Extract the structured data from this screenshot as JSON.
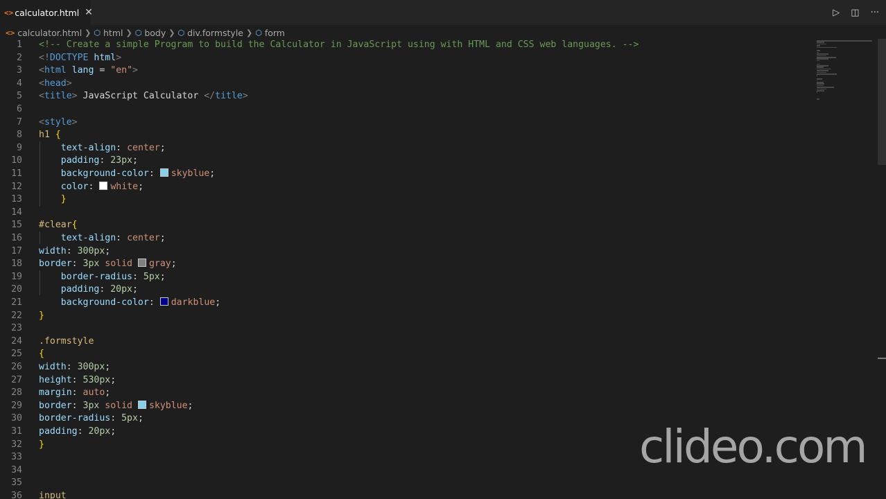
{
  "tab": {
    "filename": "calculator.html",
    "close_glyph": "✕"
  },
  "actions": {
    "run_glyph": "▷",
    "split_glyph": "◫",
    "more_glyph": "···"
  },
  "breadcrumb": [
    "calculator.html",
    "html",
    "body",
    "div.formstyle",
    "form"
  ],
  "swatch_colors": {
    "skyblue": "#87ceeb",
    "white": "#ffffff",
    "gray": "#808080",
    "darkblue": "#00008b"
  },
  "watermark": "clideo.com",
  "lines": [
    {
      "n": "1",
      "t": [
        {
          "c": "comment",
          "v": "<!-- Create a simple Program to build the Calculator in JavaScript using with HTML and CSS web languages. -->"
        }
      ]
    },
    {
      "n": "2",
      "t": [
        {
          "c": "tag",
          "v": "<!"
        },
        {
          "c": "tagname",
          "v": "DOCTYPE "
        },
        {
          "c": "attr",
          "v": "html"
        },
        {
          "c": "tag",
          "v": ">"
        }
      ]
    },
    {
      "n": "3",
      "t": [
        {
          "c": "tag",
          "v": "<"
        },
        {
          "c": "tagname",
          "v": "html "
        },
        {
          "c": "attr",
          "v": "lang "
        },
        {
          "c": "text",
          "v": "= "
        },
        {
          "c": "str",
          "v": "\"en\""
        },
        {
          "c": "tag",
          "v": ">"
        }
      ]
    },
    {
      "n": "4",
      "t": [
        {
          "c": "tag",
          "v": "<"
        },
        {
          "c": "tagname",
          "v": "head"
        },
        {
          "c": "tag",
          "v": ">"
        }
      ]
    },
    {
      "n": "5",
      "t": [
        {
          "c": "tag",
          "v": "<"
        },
        {
          "c": "tagname",
          "v": "title"
        },
        {
          "c": "tag",
          "v": ">"
        },
        {
          "c": "text",
          "v": " JavaScript Calculator "
        },
        {
          "c": "tag",
          "v": "</"
        },
        {
          "c": "tagname",
          "v": "title"
        },
        {
          "c": "tag",
          "v": ">"
        }
      ]
    },
    {
      "n": "6",
      "t": []
    },
    {
      "n": "7",
      "t": [
        {
          "c": "tag",
          "v": "<"
        },
        {
          "c": "tagname",
          "v": "style"
        },
        {
          "c": "tag",
          "v": ">"
        }
      ]
    },
    {
      "n": "8",
      "t": [
        {
          "c": "sel",
          "v": "h1 "
        },
        {
          "c": "brace",
          "v": "{"
        }
      ]
    },
    {
      "n": "9",
      "t": [
        {
          "c": "text",
          "v": "    "
        },
        {
          "c": "prop",
          "v": "text-align"
        },
        {
          "c": "text",
          "v": ": "
        },
        {
          "c": "val",
          "v": "center"
        },
        {
          "c": "text",
          "v": ";"
        }
      ]
    },
    {
      "n": "10",
      "t": [
        {
          "c": "text",
          "v": "    "
        },
        {
          "c": "prop",
          "v": "padding"
        },
        {
          "c": "text",
          "v": ": "
        },
        {
          "c": "num",
          "v": "23px"
        },
        {
          "c": "text",
          "v": ";"
        }
      ]
    },
    {
      "n": "11",
      "t": [
        {
          "c": "text",
          "v": "    "
        },
        {
          "c": "prop",
          "v": "background-color"
        },
        {
          "c": "text",
          "v": ": "
        },
        {
          "c": "swatch",
          "v": "skyblue"
        },
        {
          "c": "val",
          "v": "skyblue"
        },
        {
          "c": "text",
          "v": ";"
        }
      ]
    },
    {
      "n": "12",
      "t": [
        {
          "c": "text",
          "v": "    "
        },
        {
          "c": "prop",
          "v": "color"
        },
        {
          "c": "text",
          "v": ": "
        },
        {
          "c": "swatch",
          "v": "white"
        },
        {
          "c": "val",
          "v": "white"
        },
        {
          "c": "text",
          "v": ";"
        }
      ]
    },
    {
      "n": "13",
      "t": [
        {
          "c": "text",
          "v": "    "
        },
        {
          "c": "brace",
          "v": "}"
        }
      ]
    },
    {
      "n": "14",
      "t": []
    },
    {
      "n": "15",
      "t": [
        {
          "c": "sel",
          "v": "#clear"
        },
        {
          "c": "brace",
          "v": "{"
        }
      ]
    },
    {
      "n": "16",
      "t": [
        {
          "c": "text",
          "v": "    "
        },
        {
          "c": "prop",
          "v": "text-align"
        },
        {
          "c": "text",
          "v": ": "
        },
        {
          "c": "val",
          "v": "center"
        },
        {
          "c": "text",
          "v": ";"
        }
      ]
    },
    {
      "n": "17",
      "t": [
        {
          "c": "prop",
          "v": "width"
        },
        {
          "c": "text",
          "v": ": "
        },
        {
          "c": "num",
          "v": "300px"
        },
        {
          "c": "text",
          "v": ";"
        }
      ]
    },
    {
      "n": "18",
      "t": [
        {
          "c": "prop",
          "v": "border"
        },
        {
          "c": "text",
          "v": ": "
        },
        {
          "c": "num",
          "v": "3px "
        },
        {
          "c": "val",
          "v": "solid "
        },
        {
          "c": "swatch",
          "v": "gray"
        },
        {
          "c": "val",
          "v": "gray"
        },
        {
          "c": "text",
          "v": ";"
        }
      ]
    },
    {
      "n": "19",
      "t": [
        {
          "c": "text",
          "v": "    "
        },
        {
          "c": "prop",
          "v": "border-radius"
        },
        {
          "c": "text",
          "v": ": "
        },
        {
          "c": "num",
          "v": "5px"
        },
        {
          "c": "text",
          "v": ";"
        }
      ]
    },
    {
      "n": "20",
      "t": [
        {
          "c": "text",
          "v": "    "
        },
        {
          "c": "prop",
          "v": "padding"
        },
        {
          "c": "text",
          "v": ": "
        },
        {
          "c": "num",
          "v": "20px"
        },
        {
          "c": "text",
          "v": ";"
        }
      ]
    },
    {
      "n": "21",
      "t": [
        {
          "c": "text",
          "v": "    "
        },
        {
          "c": "prop",
          "v": "background-color"
        },
        {
          "c": "text",
          "v": ": "
        },
        {
          "c": "swatch",
          "v": "darkblue"
        },
        {
          "c": "val",
          "v": "darkblue"
        },
        {
          "c": "text",
          "v": ";"
        }
      ]
    },
    {
      "n": "22",
      "t": [
        {
          "c": "brace",
          "v": "}"
        }
      ]
    },
    {
      "n": "23",
      "t": []
    },
    {
      "n": "24",
      "t": [
        {
          "c": "sel",
          "v": ".formstyle"
        }
      ]
    },
    {
      "n": "25",
      "t": [
        {
          "c": "brace",
          "v": "{"
        }
      ]
    },
    {
      "n": "26",
      "t": [
        {
          "c": "prop",
          "v": "width"
        },
        {
          "c": "text",
          "v": ": "
        },
        {
          "c": "num",
          "v": "300px"
        },
        {
          "c": "text",
          "v": ";"
        }
      ]
    },
    {
      "n": "27",
      "t": [
        {
          "c": "prop",
          "v": "height"
        },
        {
          "c": "text",
          "v": ": "
        },
        {
          "c": "num",
          "v": "530px"
        },
        {
          "c": "text",
          "v": ";"
        }
      ]
    },
    {
      "n": "28",
      "t": [
        {
          "c": "prop",
          "v": "margin"
        },
        {
          "c": "text",
          "v": ": "
        },
        {
          "c": "val",
          "v": "auto"
        },
        {
          "c": "text",
          "v": ";"
        }
      ]
    },
    {
      "n": "29",
      "t": [
        {
          "c": "prop",
          "v": "border"
        },
        {
          "c": "text",
          "v": ": "
        },
        {
          "c": "num",
          "v": "3px "
        },
        {
          "c": "val",
          "v": "solid "
        },
        {
          "c": "swatch",
          "v": "skyblue"
        },
        {
          "c": "val",
          "v": "skyblue"
        },
        {
          "c": "text",
          "v": ";"
        }
      ]
    },
    {
      "n": "30",
      "t": [
        {
          "c": "prop",
          "v": "border-radius"
        },
        {
          "c": "text",
          "v": ": "
        },
        {
          "c": "num",
          "v": "5px"
        },
        {
          "c": "text",
          "v": ";"
        }
      ]
    },
    {
      "n": "31",
      "t": [
        {
          "c": "prop",
          "v": "padding"
        },
        {
          "c": "text",
          "v": ": "
        },
        {
          "c": "num",
          "v": "20px"
        },
        {
          "c": "text",
          "v": ";"
        }
      ]
    },
    {
      "n": "32",
      "t": [
        {
          "c": "brace",
          "v": "}"
        }
      ]
    },
    {
      "n": "33",
      "t": []
    },
    {
      "n": "34",
      "t": []
    },
    {
      "n": "35",
      "t": []
    },
    {
      "n": "36",
      "t": [
        {
          "c": "sel",
          "v": "input"
        }
      ]
    }
  ]
}
